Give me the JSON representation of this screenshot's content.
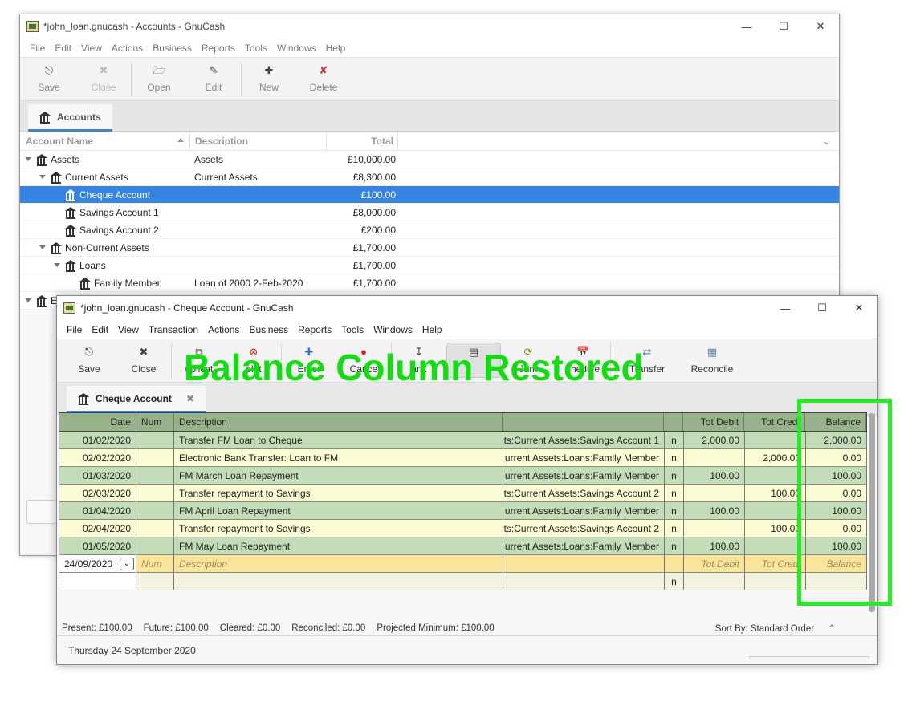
{
  "back_window": {
    "title": "*john_loan.gnucash - Accounts - GnuCash",
    "menu": [
      "File",
      "Edit",
      "View",
      "Actions",
      "Business",
      "Reports",
      "Tools",
      "Windows",
      "Help"
    ],
    "toolbar": {
      "save": "Save",
      "close": "Close",
      "open": "Open",
      "edit": "Edit",
      "new": "New",
      "delete": "Delete"
    },
    "tab": "Accounts",
    "columns": {
      "name": "Account Name",
      "description": "Description",
      "total": "Total"
    },
    "rows": [
      {
        "name": "Assets",
        "description": "Assets",
        "total": "£10,000.00",
        "level": 0,
        "expander": "down"
      },
      {
        "name": "Current Assets",
        "description": "Current Assets",
        "total": "£8,300.00",
        "level": 1,
        "expander": "down"
      },
      {
        "name": "Cheque Account",
        "description": "",
        "total": "£100.00",
        "level": 2,
        "expander": "none",
        "selected": true
      },
      {
        "name": "Savings Account 1",
        "description": "",
        "total": "£8,000.00",
        "level": 2,
        "expander": "none"
      },
      {
        "name": "Savings Account 2",
        "description": "",
        "total": "£200.00",
        "level": 2,
        "expander": "none"
      },
      {
        "name": "Non-Current Assets",
        "description": "",
        "total": "£1,700.00",
        "level": 1,
        "expander": "down"
      },
      {
        "name": "Loans",
        "description": "",
        "total": "£1,700.00",
        "level": 2,
        "expander": "down"
      },
      {
        "name": "Family Member",
        "description": "Loan of 2000 2-Feb-2020",
        "total": "£1,700.00",
        "level": 3,
        "expander": "none"
      },
      {
        "name": "E",
        "description": "",
        "total": "",
        "level": 0,
        "expander": "down"
      }
    ]
  },
  "front_window": {
    "title": "*john_loan.gnucash - Cheque Account - GnuCash",
    "menu": [
      "File",
      "Edit",
      "View",
      "Transaction",
      "Actions",
      "Business",
      "Reports",
      "Tools",
      "Windows",
      "Help"
    ],
    "toolbar": {
      "save": "Save",
      "close": "Close",
      "duplicate": "uplicat",
      "delete": "elet",
      "enter": "Enter",
      "cancel": "Cance",
      "blank": "ank",
      "split": "",
      "jump": "Jum",
      "schedule": "chedule",
      "transfer": "Transfer",
      "reconcile": "Reconcile"
    },
    "tab": "Cheque Account",
    "columns": {
      "date": "Date",
      "num": "Num",
      "description": "Description",
      "transfer": "",
      "r": "",
      "debit": "Tot Debit",
      "credit": "Tot Credi",
      "balance": "Balance"
    },
    "rows": [
      {
        "date": "01/02/2020",
        "num": "",
        "description": "Transfer FM Loan to Cheque",
        "transfer": "ts:Current Assets:Savings Account 1",
        "r": "n",
        "debit": "2,000.00",
        "credit": "",
        "balance": "2,000.00",
        "shade": "g"
      },
      {
        "date": "02/02/2020",
        "num": "",
        "description": "Electronic Bank Transfer: Loan to FM",
        "transfer": "urrent Assets:Loans:Family Member",
        "r": "n",
        "debit": "",
        "credit": "2,000.00",
        "balance": "0.00",
        "shade": "y"
      },
      {
        "date": "01/03/2020",
        "num": "",
        "description": "FM March Loan Repayment",
        "transfer": "urrent Assets:Loans:Family Member",
        "r": "n",
        "debit": "100.00",
        "credit": "",
        "balance": "100.00",
        "shade": "g"
      },
      {
        "date": "02/03/2020",
        "num": "",
        "description": "Transfer repayment to Savings",
        "transfer": "ts:Current Assets:Savings Account 2",
        "r": "n",
        "debit": "",
        "credit": "100.00",
        "balance": "0.00",
        "shade": "y"
      },
      {
        "date": "01/04/2020",
        "num": "",
        "description": "FM April Loan Repayment",
        "transfer": "urrent Assets:Loans:Family Member",
        "r": "n",
        "debit": "100.00",
        "credit": "",
        "balance": "100.00",
        "shade": "g"
      },
      {
        "date": "02/04/2020",
        "num": "",
        "description": "Transfer repayment to Savings",
        "transfer": "ts:Current Assets:Savings Account 2",
        "r": "n",
        "debit": "",
        "credit": "100.00",
        "balance": "0.00",
        "shade": "y"
      },
      {
        "date": "01/05/2020",
        "num": "",
        "description": "FM May Loan Repayment",
        "transfer": "urrent Assets:Loans:Family Member",
        "r": "n",
        "debit": "100.00",
        "credit": "",
        "balance": "100.00",
        "shade": "g"
      }
    ],
    "entry_row": {
      "date": "24/09/2020",
      "num": "Num",
      "description": "Description",
      "debit": "Tot Debit",
      "credit": "Tot Credi",
      "balance": "Balance",
      "r": "n"
    },
    "status": {
      "present": "Present: £100.00",
      "future": "Future: £100.00",
      "cleared": "Cleared: £0.00",
      "reconciled": "Reconciled: £0.00",
      "projected": "Projected Minimum: £100.00",
      "sort": "Sort By: Standard Order"
    },
    "date_bar": "Thursday 24 September 2020"
  },
  "annotation": {
    "text": "Balance Column Restored",
    "color": "#11dd11"
  }
}
